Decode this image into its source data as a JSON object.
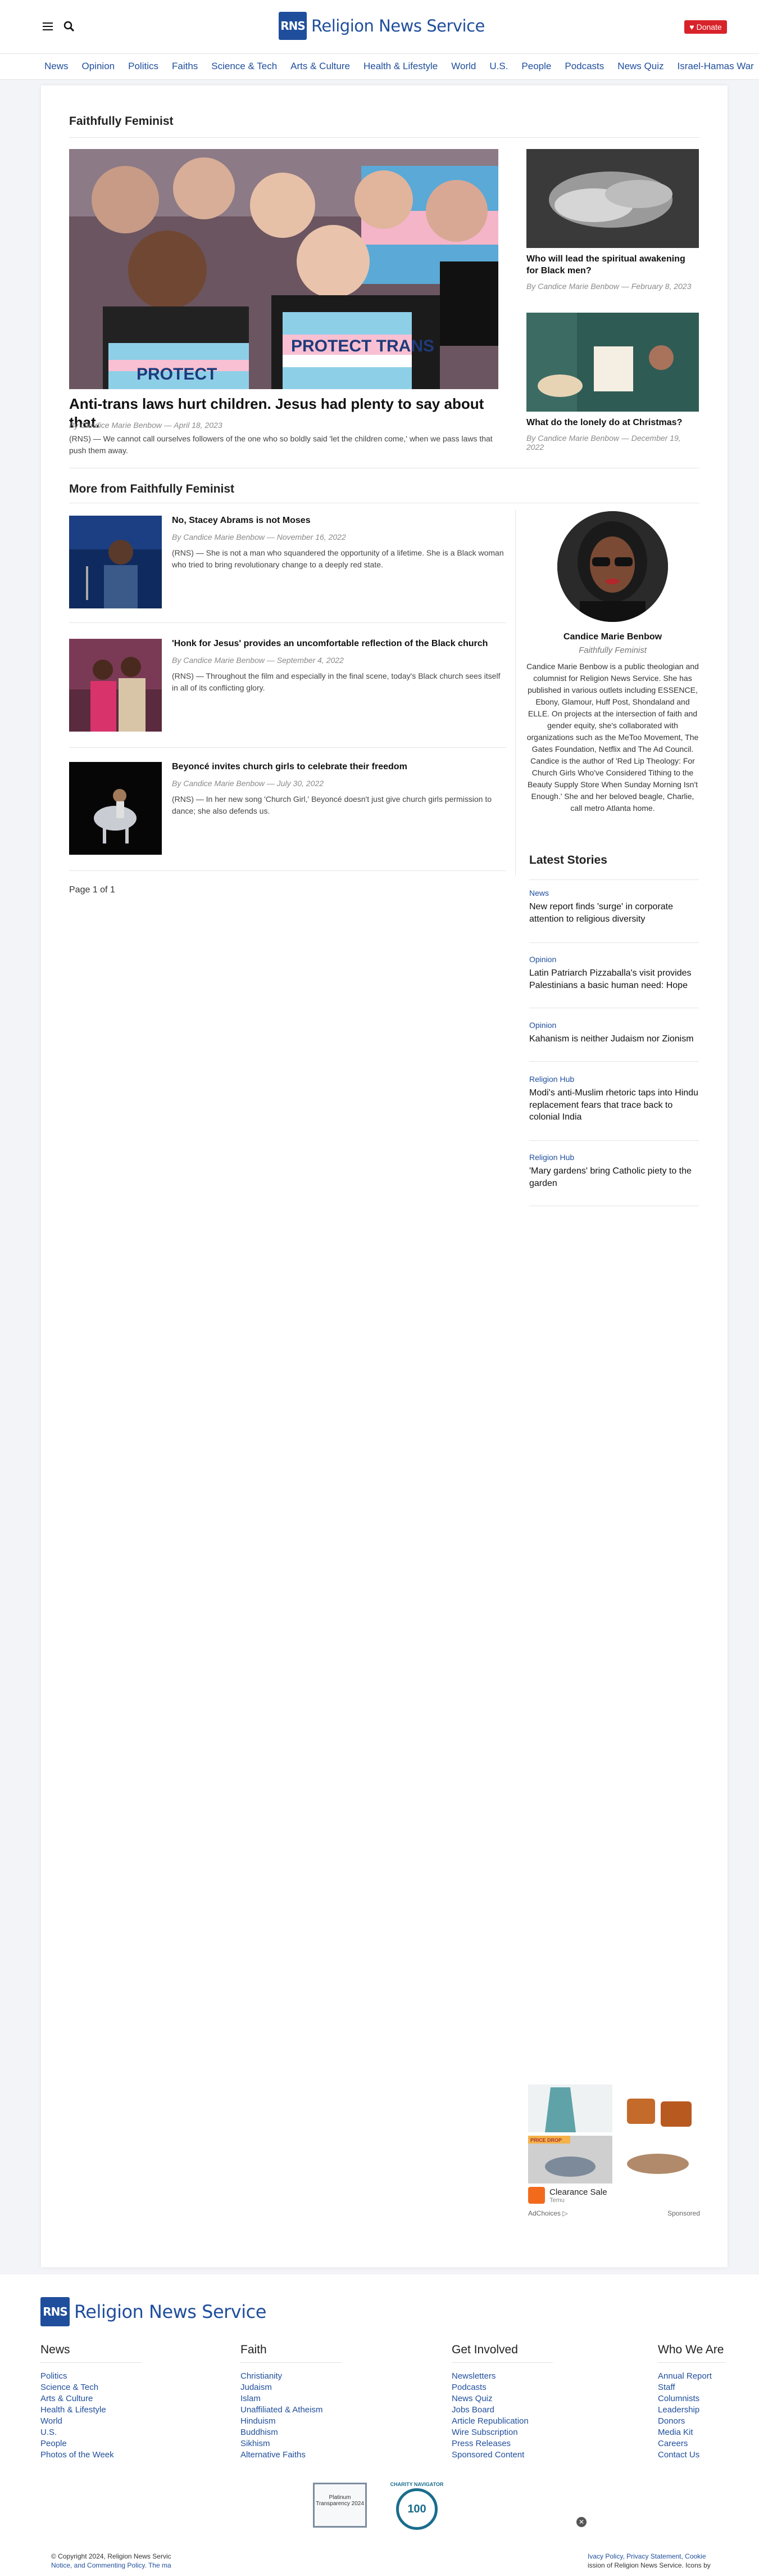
{
  "header": {
    "logo_mark": "RNS",
    "logo_text": "Religion News Service",
    "donate_label": "Donate"
  },
  "nav": [
    "News",
    "Opinion",
    "Politics",
    "Faiths",
    "Science & Tech",
    "Arts & Culture",
    "Health & Lifestyle",
    "World",
    "U.S.",
    "People",
    "Podcasts",
    "News Quiz",
    "Israel-Hamas War"
  ],
  "column": {
    "title": "Faithfully Feminist",
    "hero": {
      "title": "Anti-trans laws hurt children. Jesus had plenty to say about that.",
      "byline": "By Candice Marie Benbow — April 18, 2023",
      "excerpt": "(RNS) — We cannot call ourselves followers of the one who so boldly said 'let the children come,' when we pass laws that push them away.",
      "sign_text_1": "PROTECT",
      "sign_text_2": "PROTECT TRANS"
    },
    "side": [
      {
        "title": "Who will lead the spiritual awakening for Black men?",
        "byline": "By Candice Marie Benbow — February 8, 2023"
      },
      {
        "title": "What do the lonely do at Christmas?",
        "byline": "By Candice Marie Benbow — December 19, 2022"
      }
    ]
  },
  "more": {
    "title": "More from Faithfully Feminist",
    "items": [
      {
        "title": "No, Stacey Abrams is not Moses",
        "byline": "By Candice Marie Benbow — November 16, 2022",
        "excerpt": "(RNS) — She is not a man who squandered the opportunity of a lifetime. She is a Black woman who tried to bring revolutionary change to a deeply red state."
      },
      {
        "title": "'Honk for Jesus' provides an uncomfortable reflection of the Black church",
        "byline": "By Candice Marie Benbow — September 4, 2022",
        "excerpt": "(RNS) — Throughout the film and especially in the final scene, today's Black church sees itself in all of its conflicting glory."
      },
      {
        "title": "Beyoncé invites church girls to celebrate their freedom",
        "byline": "By Candice Marie Benbow — July 30, 2022",
        "excerpt": "(RNS) — In her new song 'Church Girl,' Beyoncé doesn't just give church girls permission to dance; she also defends us."
      }
    ],
    "pager": "Page 1 of 1"
  },
  "author": {
    "name": "Candice Marie Benbow",
    "role": "Faithfully Feminist",
    "bio": "Candice Marie Benbow is a public theologian and columnist for Religion News Service. She has published in various outlets including ESSENCE, Ebony, Glamour, Huff Post, Shondaland and ELLE. On projects at the intersection of faith and gender equity, she's collaborated with organizations such as the MeToo Movement, The Gates Foundation, Netflix and The Ad Council. Candice is the author of 'Red Lip Theology: For Church Girls Who've Considered Tithing to the Beauty Supply Store When Sunday Morning Isn't Enough.' She and her beloved beagle, Charlie, call metro Atlanta home."
  },
  "latest": {
    "title": "Latest Stories",
    "items": [
      {
        "category": "News",
        "headline": "New report finds 'surge' in corporate attention to religious diversity"
      },
      {
        "category": "Opinion",
        "headline": "Latin Patriarch Pizzaballa's visit provides Palestinians a basic human need: Hope"
      },
      {
        "category": "Opinion",
        "headline": "Kahanism is neither Judaism nor Zionism"
      },
      {
        "category": "Religion Hub",
        "headline": "Modi's anti-Muslim rhetoric taps into Hindu replacement fears that trace back to colonial India"
      },
      {
        "category": "Religion Hub",
        "headline": "'Mary gardens' bring Catholic piety to the garden"
      }
    ]
  },
  "ad": {
    "advertiser": "Clearance Sale",
    "brand": "Temu",
    "choices": "AdChoices",
    "sponsored": "Sponsored",
    "price_tag": "PRICE DROP"
  },
  "footer": {
    "logo_mark": "RNS",
    "logo_text": "Religion News Service",
    "columns": [
      {
        "title": "News",
        "links": [
          "Politics",
          "Science & Tech",
          "Arts & Culture",
          "Health & Lifestyle",
          "World",
          "U.S.",
          "People",
          "Photos of the Week"
        ]
      },
      {
        "title": "Faith",
        "links": [
          "Christianity",
          "Judaism",
          "Islam",
          "Unaffiliated & Atheism",
          "Hinduism",
          "Buddhism",
          "Sikhism",
          "Alternative Faiths"
        ]
      },
      {
        "title": "Get Involved",
        "links": [
          "Newsletters",
          "Podcasts",
          "News Quiz",
          "Jobs Board",
          "Article Republication",
          "Wire Subscription",
          "Press Releases",
          "Sponsored Content"
        ]
      },
      {
        "title": "Who We Are",
        "links": [
          "Annual Report",
          "Staff",
          "Columnists",
          "Leadership",
          "Donors",
          "Media Kit",
          "Careers",
          "Contact Us"
        ]
      }
    ],
    "badge1_text": "Platinum Transparency 2024",
    "badge2_text": "100",
    "badge2_caption": "CHARITY NAVIGATOR",
    "copyright_left": "© Copyright 2024, Religion News Servic",
    "copyright_left_2": "Notice, and Commenting Policy. The ma",
    "copyright_right": "Ivacy Policy, Privacy Statement, Cookie",
    "copyright_right_2": "ission of Religion News Service. Icons by"
  },
  "colors": {
    "brand_blue": "#1f4e9c",
    "donate_red": "#d8232a",
    "page_bg": "#f3f4f8"
  },
  "icons": [
    "menu-icon",
    "search-icon",
    "heart-icon",
    "close-icon",
    "adchoices-icon"
  ]
}
